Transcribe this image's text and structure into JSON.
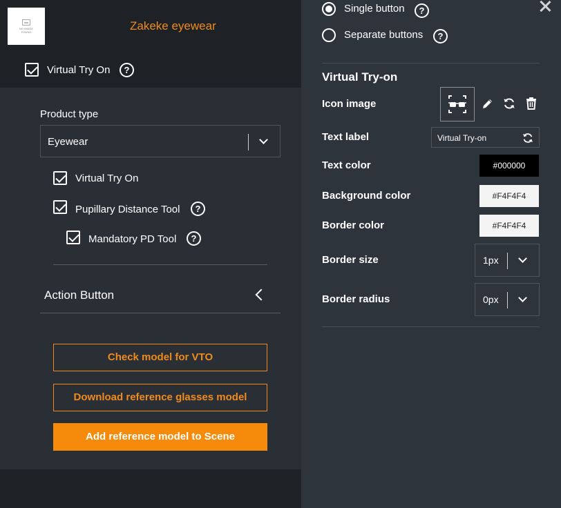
{
  "product": {
    "thumbnail_text": "NO IMAGE FOUND",
    "name": "Zakeke eyewear",
    "vto_label": "Virtual Try On",
    "vto_help": "?"
  },
  "settings": {
    "product_type_label": "Product type",
    "product_type_value": "Eyewear",
    "options": [
      {
        "label": "Virtual Try On",
        "checked": true
      },
      {
        "label": "Pupillary Distance Tool",
        "checked": true,
        "help": "?"
      },
      {
        "label": "Mandatory PD Tool",
        "checked": true,
        "help": "?"
      }
    ],
    "accordion_title": "Action Button"
  },
  "actions": {
    "check_model": "Check model for VTO",
    "download_model": "Download reference glasses model",
    "add_model": "Add reference model to Scene"
  },
  "right_panel": {
    "close_label": "close",
    "button_mode": [
      {
        "label": "Single button",
        "selected": true,
        "help": "?"
      },
      {
        "label": "Separate buttons",
        "selected": false,
        "help": "?"
      }
    ],
    "section_title": "Virtual Try-on",
    "icon_image_label": "Icon image",
    "text_label_label": "Text label",
    "text_label_value": "Virtual Try-on",
    "text_color_label": "Text color",
    "text_color_value": "#000000",
    "background_color_label": "Background color",
    "background_color_value": "#F4F4F4",
    "border_color_label": "Border color",
    "border_color_value": "#F4F4F4",
    "border_size_label": "Border size",
    "border_size_value": "1px",
    "border_radius_label": "Border radius",
    "border_radius_value": "0px"
  },
  "icons": {
    "glasses": "glasses-icon",
    "edit": "pencil-icon",
    "reset": "refresh-icon",
    "delete": "trash-icon"
  },
  "colors": {
    "accent": "#F58A0B",
    "panel_dark": "#1E2226",
    "panel": "#2A2F35",
    "panel_right": "#2E343B"
  }
}
